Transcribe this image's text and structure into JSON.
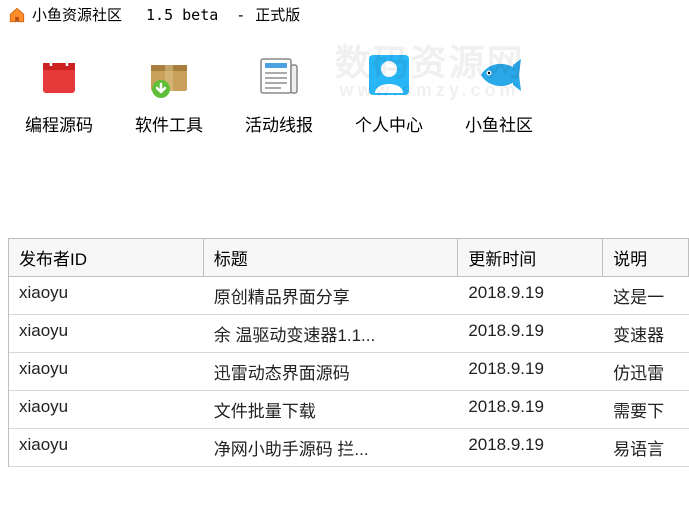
{
  "title": {
    "app_name": "小鱼资源社区",
    "version": "1.5 beta",
    "separator": "-",
    "edition": "正式版"
  },
  "watermark": {
    "line1": "数码资源网",
    "line2": "www.smzy.com"
  },
  "toolbar": [
    {
      "label": "编程源码",
      "icon": "shopping-bag-icon"
    },
    {
      "label": "软件工具",
      "icon": "package-download-icon"
    },
    {
      "label": "活动线报",
      "icon": "newspaper-icon"
    },
    {
      "label": "个人中心",
      "icon": "user-icon"
    },
    {
      "label": "小鱼社区",
      "icon": "fish-icon"
    }
  ],
  "table": {
    "columns": [
      "发布者ID",
      "标题",
      "更新时间",
      "说明"
    ],
    "rows": [
      {
        "publisher": "xiaoyu",
        "title": "原创精品界面分享",
        "date": "2018.9.19",
        "desc": "这是一"
      },
      {
        "publisher": "xiaoyu",
        "title": "余 温驱动变速器1.1...",
        "date": "2018.9.19",
        "desc": "变速器"
      },
      {
        "publisher": "xiaoyu",
        "title": "迅雷动态界面源码",
        "date": "2018.9.19",
        "desc": "仿迅雷"
      },
      {
        "publisher": "xiaoyu",
        "title": "文件批量下载",
        "date": "2018.9.19",
        "desc": "需要下"
      },
      {
        "publisher": "xiaoyu",
        "title": "净网小助手源码 拦...",
        "date": "2018.9.19",
        "desc": "易语言"
      }
    ]
  }
}
